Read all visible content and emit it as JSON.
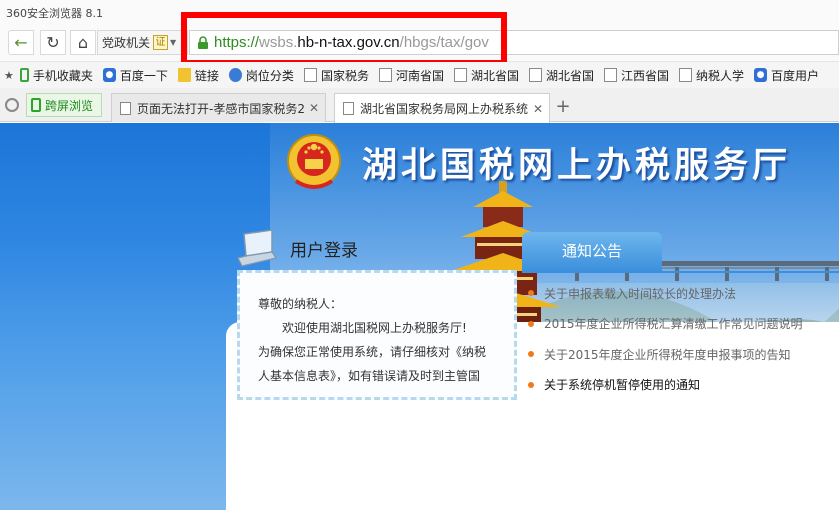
{
  "app": {
    "title": "360安全浏览器 8.1"
  },
  "toolbar": {
    "zone_label": "党政机关",
    "cert_label": "证",
    "url": {
      "scheme": "https://",
      "host_prefix": "wsbs.",
      "host": "hb-n-tax.gov.cn",
      "path": "/hbgs/tax/gov"
    }
  },
  "bookmarks": [
    {
      "label": "手机收藏夹",
      "icon": "phone-icon"
    },
    {
      "label": "百度一下",
      "icon": "baidu-paw-icon"
    },
    {
      "label": "链接",
      "icon": "folder-icon"
    },
    {
      "label": "岗位分类",
      "icon": "globe-icon"
    },
    {
      "label": "国家税务",
      "icon": "page-icon"
    },
    {
      "label": "河南省国",
      "icon": "page-icon"
    },
    {
      "label": "湖北省国",
      "icon": "page-icon"
    },
    {
      "label": "湖北省国",
      "icon": "page-icon"
    },
    {
      "label": "江西省国",
      "icon": "page-icon"
    },
    {
      "label": "纳税人学",
      "icon": "page-icon"
    },
    {
      "label": "百度用户",
      "icon": "baidu-paw-icon"
    }
  ],
  "tabs": {
    "split_view_label": "跨屏浏览",
    "items": [
      {
        "label": "页面无法打开-孝感市国家税务2",
        "active": false
      },
      {
        "label": "湖北省国家税务局网上办税系统",
        "active": true
      }
    ]
  },
  "page": {
    "banner_title": "湖北国税网上办税服务厅",
    "login": {
      "title": "用户登录",
      "greeting": "尊敬的纳税人：",
      "welcome": "欢迎使用湖北国税网上办税服务厅!",
      "line3": "为确保您正常使用系统，请仔细核对《纳税",
      "line4": "人基本信息表》，如有错误请及时到主管国"
    },
    "notice": {
      "tab_label": "通知公告",
      "items": [
        {
          "text": "关于申报表载入时间较长的处理办法",
          "bold": false
        },
        {
          "text": "2015年度企业所得税汇算清缴工作常见问题说明",
          "bold": false
        },
        {
          "text": "关于2015年度企业所得税年度申报事项的告知",
          "bold": false
        },
        {
          "text": "关于系统停机暂停使用的通知",
          "bold": true
        }
      ]
    }
  },
  "colors": {
    "highlight": "#ff0000",
    "banner_blue": "#1c76d8",
    "notice_blue": "#3b8fdc",
    "bullet_orange": "#f07a1a"
  }
}
